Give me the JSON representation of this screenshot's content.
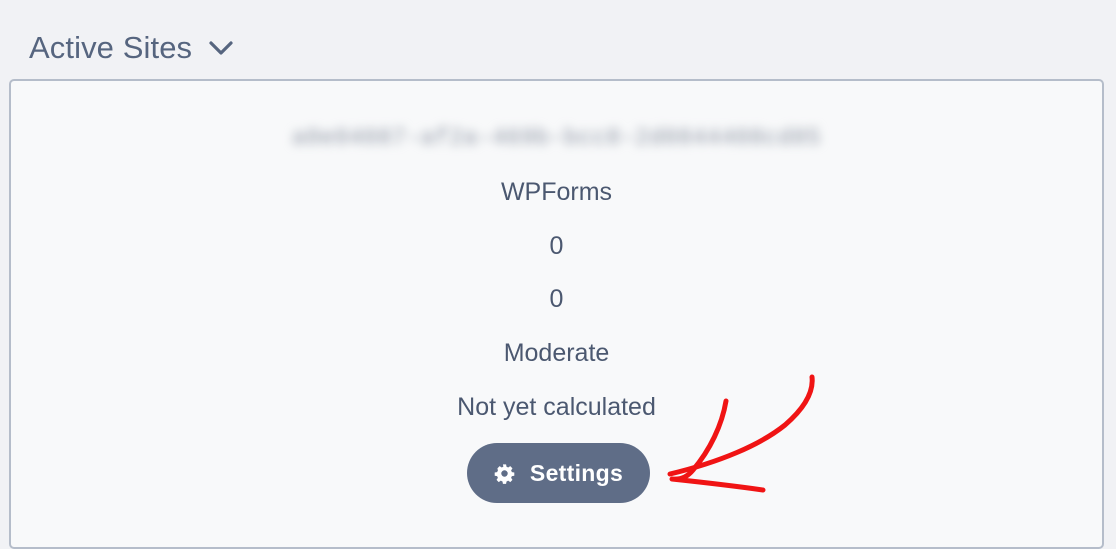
{
  "header": {
    "title": "Active Sites",
    "toggle_icon": "chevron-down-icon"
  },
  "site": {
    "license_key": "a0e04087-af2a-469b-bcc8-2d0844408cd85",
    "plugin": "WPForms",
    "value_1": "0",
    "value_2": "0",
    "level": "Moderate",
    "status": "Not yet calculated",
    "settings_label": "Settings",
    "settings_icon": "gear-icon"
  },
  "colors": {
    "background": "#f1f2f5",
    "card": "#f8f9fa",
    "border": "#b5bdca",
    "text": "#4b5870",
    "button": "#5f6d87",
    "annotation": "#f01414"
  }
}
